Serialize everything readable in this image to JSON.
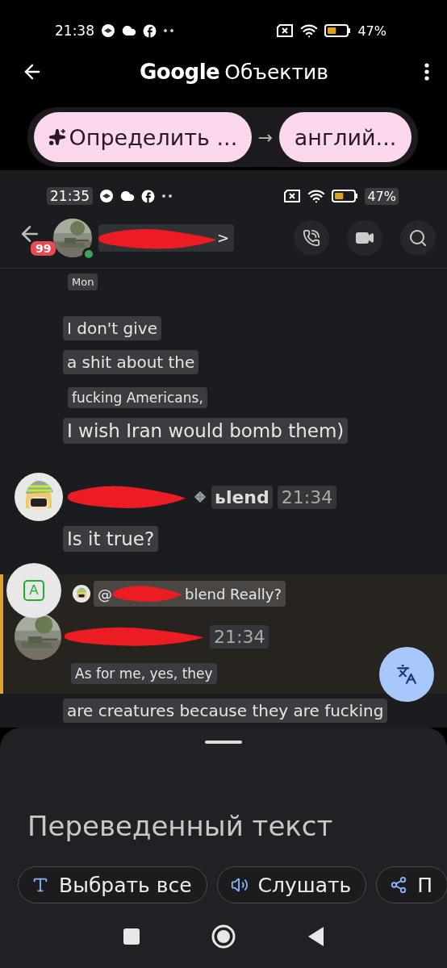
{
  "status_bar": {
    "time": "21:38",
    "battery": "47%"
  },
  "app_bar": {
    "brand": "Google",
    "title": "Объектив"
  },
  "languages": {
    "source": "Определить ...",
    "arrow": "→",
    "target": "англий..."
  },
  "screenshot": {
    "status_bar": {
      "time": "21:35",
      "battery": "47%"
    },
    "chat_header": {
      "unread": "99",
      "chevron": ">",
      "online": true
    },
    "messages": [
      {
        "kind": "date",
        "text": "Mon"
      },
      {
        "kind": "line",
        "text": "I don't give"
      },
      {
        "kind": "line",
        "text": "a shit about the"
      },
      {
        "kind": "small",
        "text": "fucking Americans,"
      },
      {
        "kind": "large",
        "text": "I wish Iran would bomb them)"
      },
      {
        "kind": "author",
        "name": "ьlend",
        "time": "21:34"
      },
      {
        "kind": "large",
        "text": "Is it true?"
      },
      {
        "kind": "reply_block",
        "highlighted": true,
        "reply": "@",
        "reply_tail": "blend Really?",
        "time": "21:34",
        "text": "As for me, yes, they"
      },
      {
        "kind": "line",
        "text": "are creatures because they are fucking"
      }
    ],
    "badge": "A"
  },
  "sheet": {
    "title": "Переведенный текст",
    "chips": [
      {
        "label": "Выбрать все"
      },
      {
        "label": "Слушать"
      },
      {
        "label": "П"
      }
    ]
  }
}
